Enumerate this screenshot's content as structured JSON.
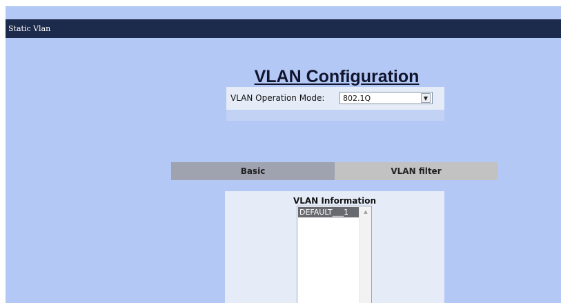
{
  "header": {
    "title": "Static Vlan"
  },
  "page": {
    "title": "VLAN Configuration"
  },
  "mode": {
    "label": "VLAN Operation Mode:",
    "selected": "802.1Q",
    "dropdown_icon": "▼",
    "dropdown_icon_name": "chevron-down-icon"
  },
  "tabs": [
    {
      "label": "Basic",
      "active": true
    },
    {
      "label": "VLAN filter",
      "active": false
    }
  ],
  "vlan_info": {
    "title": "VLAN Information",
    "items": [
      {
        "label": "DEFAULT___1",
        "selected": true
      }
    ],
    "scroll_up_icon": "▲"
  },
  "colors": {
    "background": "#b4c8f5",
    "header": "#1c2a4b",
    "panel": "#e5ecf7",
    "tab_active": "#9ea3af",
    "tab_inactive": "#c2c2c2",
    "selected_item": "#686a70"
  }
}
